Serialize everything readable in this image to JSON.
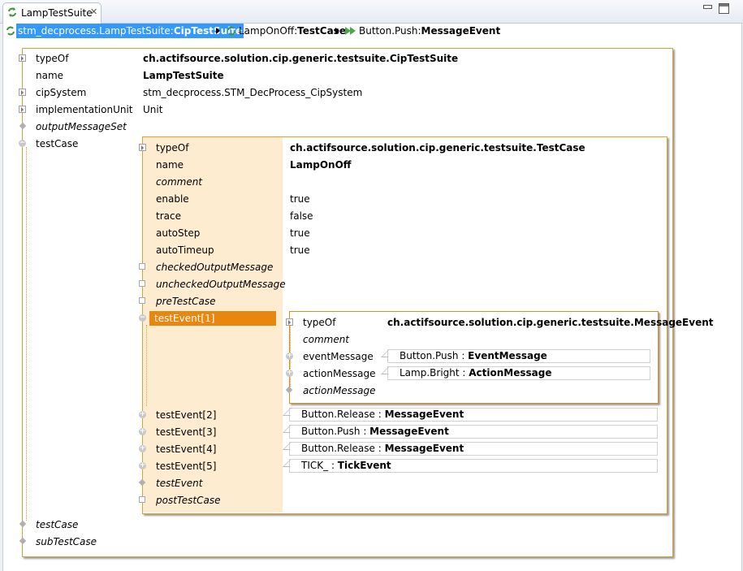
{
  "tab": {
    "title": "LampTestSuite",
    "close": "✕"
  },
  "breadcrumb": [
    {
      "prefix": "stm_decprocess.LampTestSuite:",
      "type": "CipTestSuite"
    },
    {
      "prefix": "LampOnOff:",
      "type": "TestCase"
    },
    {
      "prefix": "Button.Push:",
      "type": "MessageEvent"
    }
  ],
  "suite": {
    "rows": [
      {
        "key": "typeOf",
        "value": "ch.actifsource.solution.cip.generic.testsuite.CipTestSuite"
      },
      {
        "key": "name",
        "value": "LampTestSuite"
      },
      {
        "key": "cipSystem",
        "value": "stm_decprocess.STM_DecProcess_CipSystem"
      },
      {
        "key": "implementationUnit",
        "value": "Unit"
      },
      {
        "key": "outputMessageSet",
        "value": ""
      },
      {
        "key": "testCase",
        "value": ""
      },
      {
        "key": "testCase",
        "value": ""
      },
      {
        "key": "subTestCase",
        "value": ""
      }
    ]
  },
  "testcase": {
    "rows": [
      {
        "key": "typeOf",
        "value": "ch.actifsource.solution.cip.generic.testsuite.TestCase"
      },
      {
        "key": "name",
        "value": "LampOnOff"
      },
      {
        "key": "comment",
        "value": ""
      },
      {
        "key": "enable",
        "value": "true"
      },
      {
        "key": "trace",
        "value": "false"
      },
      {
        "key": "autoStep",
        "value": "true"
      },
      {
        "key": "autoTimeup",
        "value": "true"
      },
      {
        "key": "checkedOutputMessage",
        "value": ""
      },
      {
        "key": "uncheckedOutputMessage",
        "value": ""
      },
      {
        "key": "preTestCase",
        "value": ""
      },
      {
        "key": "testEvent[1]",
        "value": ""
      },
      {
        "key": "testEvent[2]",
        "value": ""
      },
      {
        "key": "testEvent[3]",
        "value": ""
      },
      {
        "key": "testEvent[4]",
        "value": ""
      },
      {
        "key": "testEvent[5]",
        "value": ""
      },
      {
        "key": "testEvent",
        "value": ""
      },
      {
        "key": "postTestCase",
        "value": ""
      }
    ],
    "events": [
      {
        "name": "Button.Release",
        "sep": " : ",
        "type": "MessageEvent"
      },
      {
        "name": "Button.Push",
        "sep": " : ",
        "type": "MessageEvent"
      },
      {
        "name": "Button.Release",
        "sep": " : ",
        "type": "MessageEvent"
      },
      {
        "name": "TICK_",
        "sep": " : ",
        "type": "TickEvent"
      }
    ]
  },
  "messageevent": {
    "rows": [
      {
        "key": "typeOf",
        "value": "ch.actifsource.solution.cip.generic.testsuite.MessageEvent"
      },
      {
        "key": "comment",
        "value": ""
      },
      {
        "key": "eventMessage",
        "ref_name": "Button.Push",
        "sep": " : ",
        "ref_type": "EventMessage"
      },
      {
        "key": "actionMessage",
        "ref_name": "Lamp.Bright",
        "sep": " : ",
        "ref_type": "ActionMessage"
      },
      {
        "key": "actionMessage",
        "value": ""
      }
    ]
  },
  "colors": {
    "accent": "#e8860d",
    "border": "#e0a030",
    "panel": "#fdecd0",
    "selection": "#3399ff"
  }
}
